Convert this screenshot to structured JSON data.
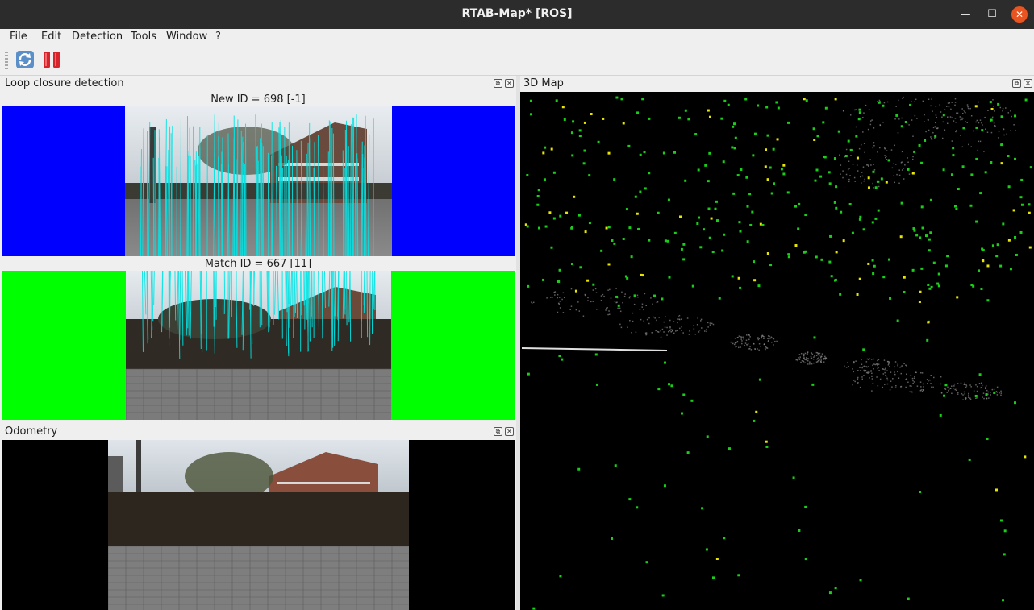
{
  "window": {
    "title": "RTAB-Map* [ROS]",
    "min_glyph": "—",
    "max_glyph": "☐",
    "close_glyph": "✕"
  },
  "menu": {
    "items": [
      "File",
      "Edit",
      "Detection",
      "Tools",
      "Window",
      "?"
    ]
  },
  "toolbar": {
    "buttons": [
      "refresh-icon",
      "pause-icon"
    ]
  },
  "loop_closure": {
    "title": "Loop closure detection",
    "new_caption": "New ID = 698 [-1]",
    "match_caption": "Match ID = 667 [11]",
    "new_bg_color": "#0000ff",
    "match_bg_color": "#00ff00"
  },
  "odometry": {
    "title": "Odometry"
  },
  "map3d": {
    "title": "3D Map"
  },
  "dock_buttons": {
    "float_glyph": "⧉",
    "close_glyph": "✕"
  }
}
